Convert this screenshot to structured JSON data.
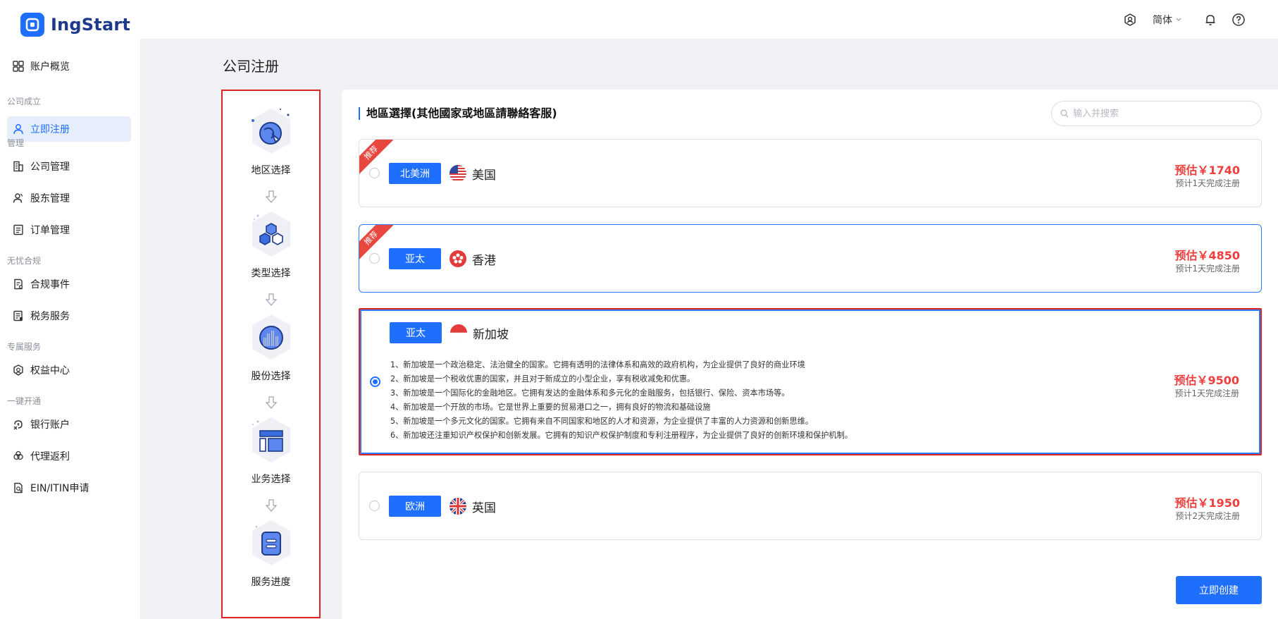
{
  "app": {
    "name": "IngStart"
  },
  "header": {
    "language": "简体"
  },
  "sidebar": {
    "overview": "账户概览",
    "groups": {
      "incorporation": "公司成立",
      "management": "管理",
      "compliance": "无忧合规",
      "exclusive": "专属服务",
      "onekey": "一键开通"
    },
    "items": {
      "register": "立即注册",
      "company": "公司管理",
      "shareholder": "股东管理",
      "order": "订单管理",
      "compliance_events": "合规事件",
      "tax": "税务服务",
      "benefits": "权益中心",
      "bank": "银行账户",
      "rebate": "代理返利",
      "ein": "EIN/ITIN申请"
    }
  },
  "page": {
    "title": "公司注册"
  },
  "steps": [
    {
      "label": "地区选择",
      "icon": "globe-icon"
    },
    {
      "label": "类型选择",
      "icon": "cubes-icon"
    },
    {
      "label": "股份选择",
      "icon": "chart-icon"
    },
    {
      "label": "业务选择",
      "icon": "layout-icon"
    },
    {
      "label": "服务进度",
      "icon": "progress-icon"
    }
  ],
  "region": {
    "title": "地區選擇(其他國家或地區請聯絡客服)",
    "search_placeholder": "输入并搜索",
    "ribbon": "推荐",
    "cards": [
      {
        "tag": "北美洲",
        "country": "美国",
        "price": "预估￥1740",
        "eta": "预计1天完成注册",
        "recommended": true,
        "selected": false
      },
      {
        "tag": "亚太",
        "country": "香港",
        "price": "预估￥4850",
        "eta": "预计1天完成注册",
        "recommended": true,
        "selected": false
      },
      {
        "tag": "亚太",
        "country": "新加坡",
        "price": "预估￥9500",
        "eta": "预计1天完成注册",
        "recommended": false,
        "selected": true,
        "details": [
          "1、新加坡是一个政治稳定、法治健全的国家。它拥有透明的法律体系和高效的政府机构，为企业提供了良好的商业环境",
          "2、新加坡是一个税收优惠的国家，并且对于新成立的小型企业，享有税收减免和优惠。",
          "3、新加坡是一个国际化的金融地区。它拥有发达的金融体系和多元化的金融服务，包括银行、保险、资本市场等。",
          "4、新加坡是一个开放的市场。它是世界上重要的贸易港口之一，拥有良好的物流和基础设施",
          "5、新加坡是一个多元文化的国家。它拥有来自不同国家和地区的人才和资源，为企业提供了丰富的人力资源和创新思维。",
          "6、新加坡还注重知识产权保护和创新发展。它拥有的知识产权保护制度和专利注册程序，为企业提供了良好的创新环境和保护机制。"
        ]
      },
      {
        "tag": "欧洲",
        "country": "英国",
        "price": "预估￥1950",
        "eta": "预计2天完成注册",
        "recommended": false,
        "selected": false
      }
    ]
  },
  "actions": {
    "create": "立即创建"
  },
  "colors": {
    "primary": "#1f6fff",
    "price": "#ef3e3e",
    "highlight": "#e02424",
    "ribbon": "#e8473f"
  }
}
